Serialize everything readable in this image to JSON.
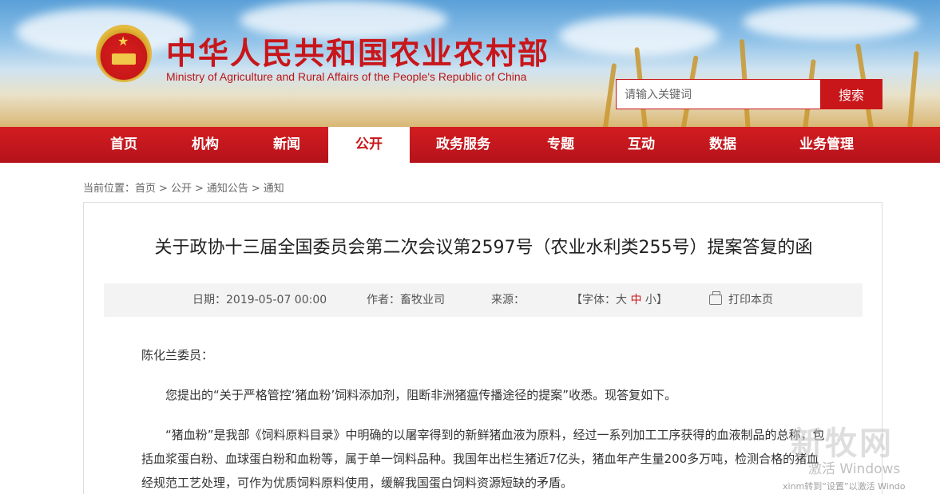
{
  "header": {
    "title": "中华人民共和国农业农村部",
    "subtitle": "Ministry of Agriculture and Rural Affairs of the People's Republic of China",
    "search_placeholder": "请输入关键词",
    "search_button": "搜索"
  },
  "nav": {
    "items": [
      {
        "label": "首页"
      },
      {
        "label": "机构"
      },
      {
        "label": "新闻"
      },
      {
        "label": "公开"
      },
      {
        "label": "政务服务"
      },
      {
        "label": "专题"
      },
      {
        "label": "互动"
      },
      {
        "label": "数据"
      },
      {
        "label": "业务管理"
      }
    ],
    "active": "公开"
  },
  "breadcrumb": {
    "prefix": "当前位置：",
    "items": [
      "首页",
      "公开",
      "通知公告",
      "通知"
    ],
    "separator": ">"
  },
  "article": {
    "title": "关于政协十三届全国委员会第二次会议第2597号（农业水利类255号）提案答复的函",
    "meta": {
      "date_label": "日期：",
      "date": "2019-05-07 00:00",
      "author_label": "作者：",
      "author": "畜牧业司",
      "source_label": "来源：",
      "source": "",
      "font_open": "【字体：",
      "font_large": "大",
      "font_medium": "中",
      "font_small": "小",
      "font_close": "】",
      "print": "打印本页"
    },
    "salutation": "陈化兰委员：",
    "paragraphs": [
      "您提出的“关于严格管控‘猪血粉’饲料添加剂，阻断非洲猪瘟传播途径的提案”收悉。现答复如下。",
      "“猪血粉”是我部《饲料原料目录》中明确的以屠宰得到的新鲜猪血液为原料，经过一系列加工工序获得的血液制品的总称，包括血浆蛋白粉、血球蛋白粉和血粉等，属于单一饲料品种。我国年出栏生猪近7亿头，猪血年产生量200多万吨，检测合格的猪血经规范工艺处理，可作为优质饲料原料使用，缓解我国蛋白饲料资源短缺的矛盾。"
    ]
  },
  "watermark": {
    "brand": "新牧网",
    "activate": "激活 Windows",
    "bottom": "xinm转到“设置”以激活 Windo"
  },
  "colors": {
    "brand_red": "#c8161a",
    "meta_bg": "#f3f3f3"
  },
  "icons": [
    "national-emblem-icon",
    "print-icon"
  ]
}
